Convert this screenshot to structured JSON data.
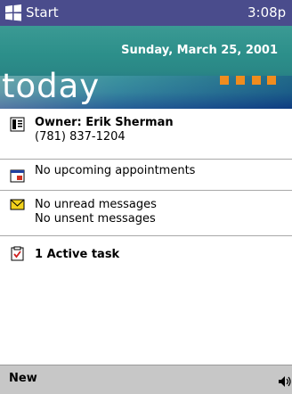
{
  "titlebar": {
    "start_label": "Start",
    "clock": "3:08p"
  },
  "banner": {
    "date": "Sunday, March 25, 2001",
    "title": "today",
    "dot_color": "#f08c1e"
  },
  "rows": [
    {
      "icon": "contact-card-icon",
      "lines": [
        "Owner: Erik Sherman",
        "(781) 837-1204"
      ]
    },
    {
      "icon": "calendar-icon",
      "lines": [
        "No upcoming appointments"
      ]
    },
    {
      "icon": "envelope-icon",
      "lines": [
        "No unread messages",
        "No unsent messages"
      ]
    },
    {
      "icon": "task-clipboard-icon",
      "lines": [
        "1 Active task"
      ]
    }
  ],
  "menubar": {
    "new_label": "New",
    "speaker_icon": "speaker-icon"
  },
  "colors": {
    "titlebar": "#4a4c8c",
    "menubar": "#c7c7c7",
    "accent_orange": "#f08c1e"
  }
}
